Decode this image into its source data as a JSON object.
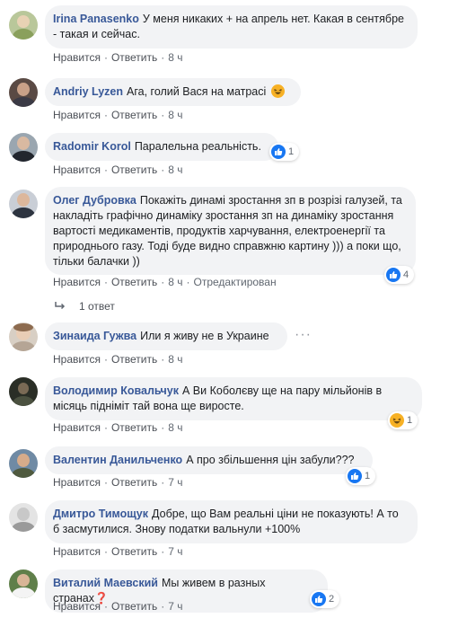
{
  "actions": {
    "like": "Нравится",
    "reply": "Ответить",
    "sep": "·"
  },
  "comments": [
    {
      "author": "Irina Panasenko",
      "text": "У меня никаких + на апрель нет. Какая в сентябре - такая и сейчас.",
      "time": "8 ч"
    },
    {
      "author": "Andriy Lyzen",
      "text": "Ага, голий Вася на матрасі",
      "time": "8 ч",
      "emoji": "laughing-face"
    },
    {
      "author": "Radomir Korol",
      "text": "Паралельна реальність.",
      "time": "8 ч",
      "reaction": {
        "type": "like",
        "count": "1"
      }
    },
    {
      "author": "Олег Дубровка",
      "text": "Покажіть динамі зростання зп в розрізі галузей, та накладіть графічно динаміку зростання зп на динаміку зростання вартості медикаментів, продуктів харчування, електроенергії та природнього газу. Тоді буде видно справжню картину ))) а поки що, тільки балачки ))",
      "time": "8 ч",
      "edited": "Отредактирован",
      "reaction": {
        "type": "like",
        "count": "4"
      },
      "replies": "1 ответ"
    },
    {
      "author": "Зинаида Гужва",
      "text": "Или я живу не в Украине",
      "time": "8 ч",
      "more": "···"
    },
    {
      "author": "Володимир Ковальчук",
      "text": "А Ви Коболєву ще на пару мільйонів в місяць підніміт тай вона ще виросте.",
      "time": "8 ч",
      "reaction": {
        "type": "haha",
        "count": "1"
      }
    },
    {
      "author": "Валентин Данильченко",
      "text": "А про збільшення цін забули???",
      "time": "7 ч",
      "reaction": {
        "type": "like",
        "count": "1"
      }
    },
    {
      "author": "Дмитро Тимощук",
      "text": "Добре, що Вам реальні ціни не показують! А то б засмутилися. Знову податки вальнули +100%",
      "time": "7 ч"
    },
    {
      "author": "Виталий Маевский",
      "text": "Мы живем в разных странах❓",
      "time": "7 ч",
      "reaction": {
        "type": "like",
        "count": "2"
      }
    }
  ]
}
